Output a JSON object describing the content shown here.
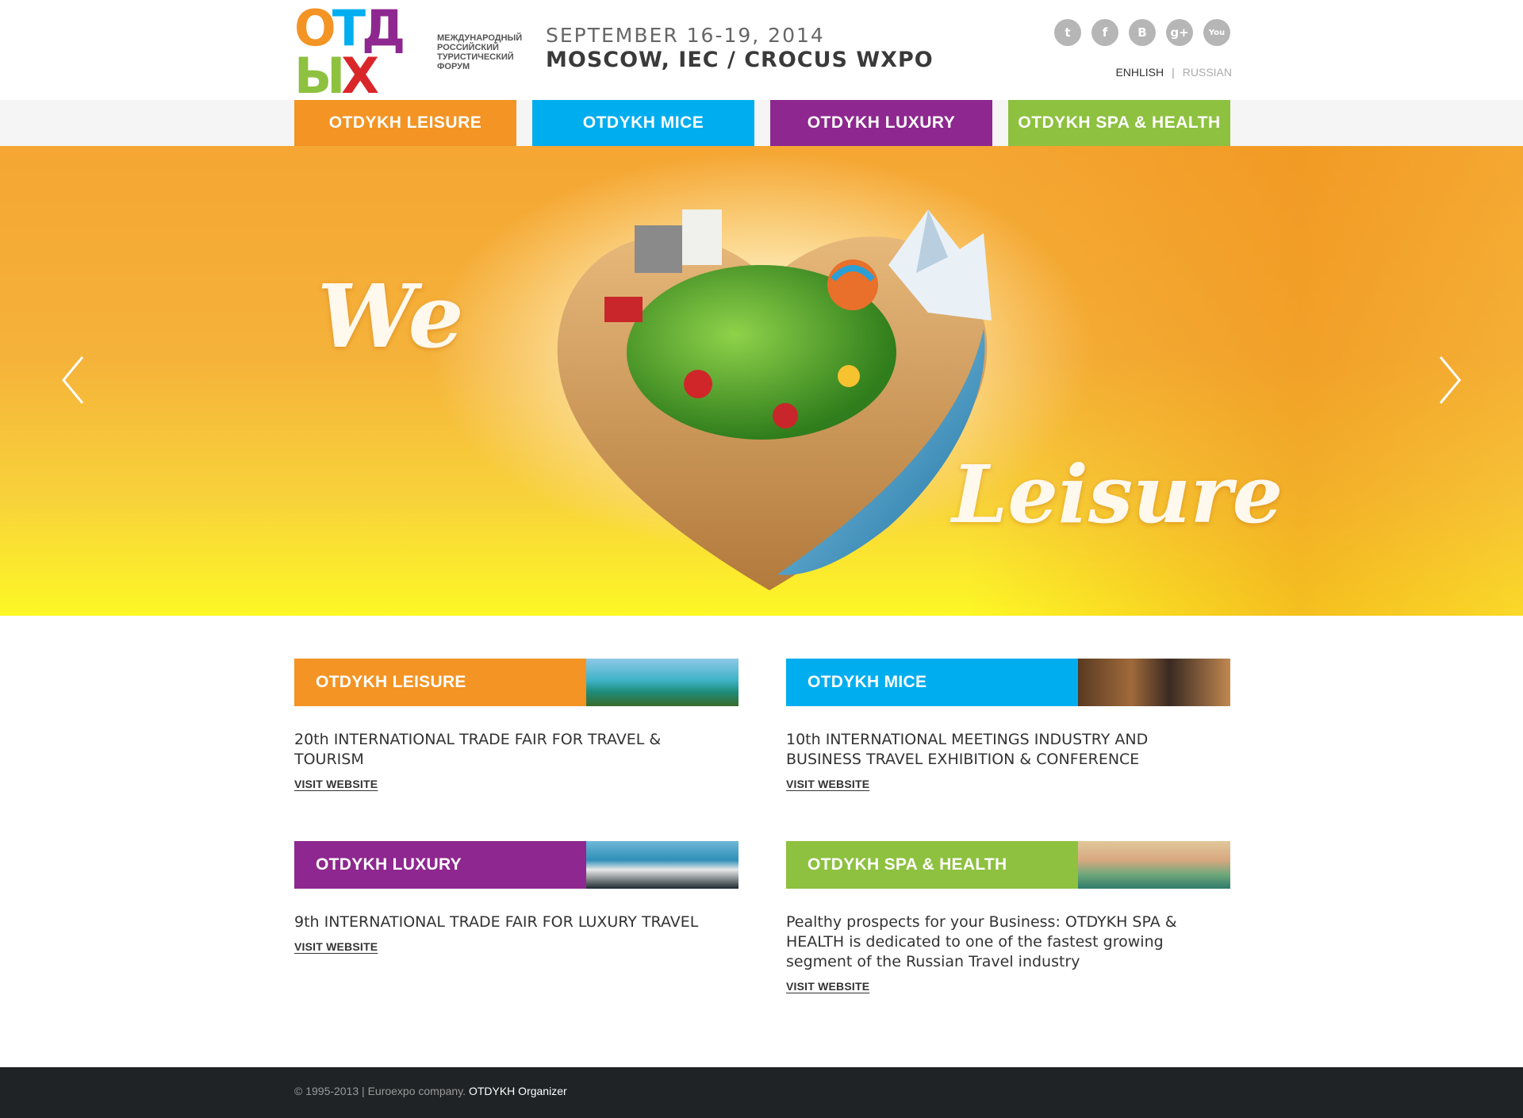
{
  "header": {
    "logo_word": "ОТДЫХ",
    "logo_subtitle": "МЕЖДУНАРОДНЫЙ РОССИЙСКИЙ ТУРИСТИЧЕСКИЙ ФОРУМ",
    "event_date": "SEPTEMBER 16-19, 2014",
    "event_place": "MOSCOW, IEC / CROCUS WXPO",
    "social": [
      {
        "name": "twitter-icon",
        "glyph": "t"
      },
      {
        "name": "facebook-icon",
        "glyph": "f"
      },
      {
        "name": "blogger-icon",
        "glyph": "B"
      },
      {
        "name": "google-plus-icon",
        "glyph": "g+"
      },
      {
        "name": "youtube-icon",
        "glyph": "You"
      }
    ],
    "lang": {
      "english": "ENHLISH",
      "separator": "|",
      "russian": "RUSSIAN"
    }
  },
  "colors": {
    "leisure": "#f39424",
    "mice": "#00aeef",
    "luxury": "#8e278f",
    "spa": "#8dc13f"
  },
  "nav": [
    {
      "label": "OTDYKH LEISURE",
      "color": "#f39424"
    },
    {
      "label": "OTDYKH MICE",
      "color": "#00aeef"
    },
    {
      "label": "OTDYKH LUXURY",
      "color": "#8e278f"
    },
    {
      "label": "OTDYKH SPA & HEALTH",
      "color": "#8dc13f"
    }
  ],
  "hero": {
    "script_we": "We",
    "script_leisure": "Leisure"
  },
  "cards": [
    {
      "title": "OTDYKH LEISURE",
      "desc": "20th INTERNATIONAL TRADE FAIR FOR TRAVEL & TOURISM",
      "link": "VISIT WEBSITE"
    },
    {
      "title": "OTDYKH MICE",
      "desc": "10th INTERNATIONAL MEETINGS INDUSTRY AND BUSINESS TRAVEL EXHIBITION & CONFERENCE",
      "link": "VISIT WEBSITE"
    },
    {
      "title": "OTDYKH LUXURY",
      "desc": "9th INTERNATIONAL TRADE FAIR FOR LUXURY TRAVEL",
      "link": "VISIT WEBSITE"
    },
    {
      "title": "OTDYKH SPA & HEALTH",
      "desc": "Pealthy prospects for your Business: OTDYKH SPA & HEALTH is dedicated to one of the fastest growing segment of the Russian Travel industry",
      "link": "VISIT WEBSITE"
    }
  ],
  "footer": {
    "copyright": "© 1995-2013 | Euroexpo company.",
    "organizer": "OTDYKH Organizer"
  }
}
